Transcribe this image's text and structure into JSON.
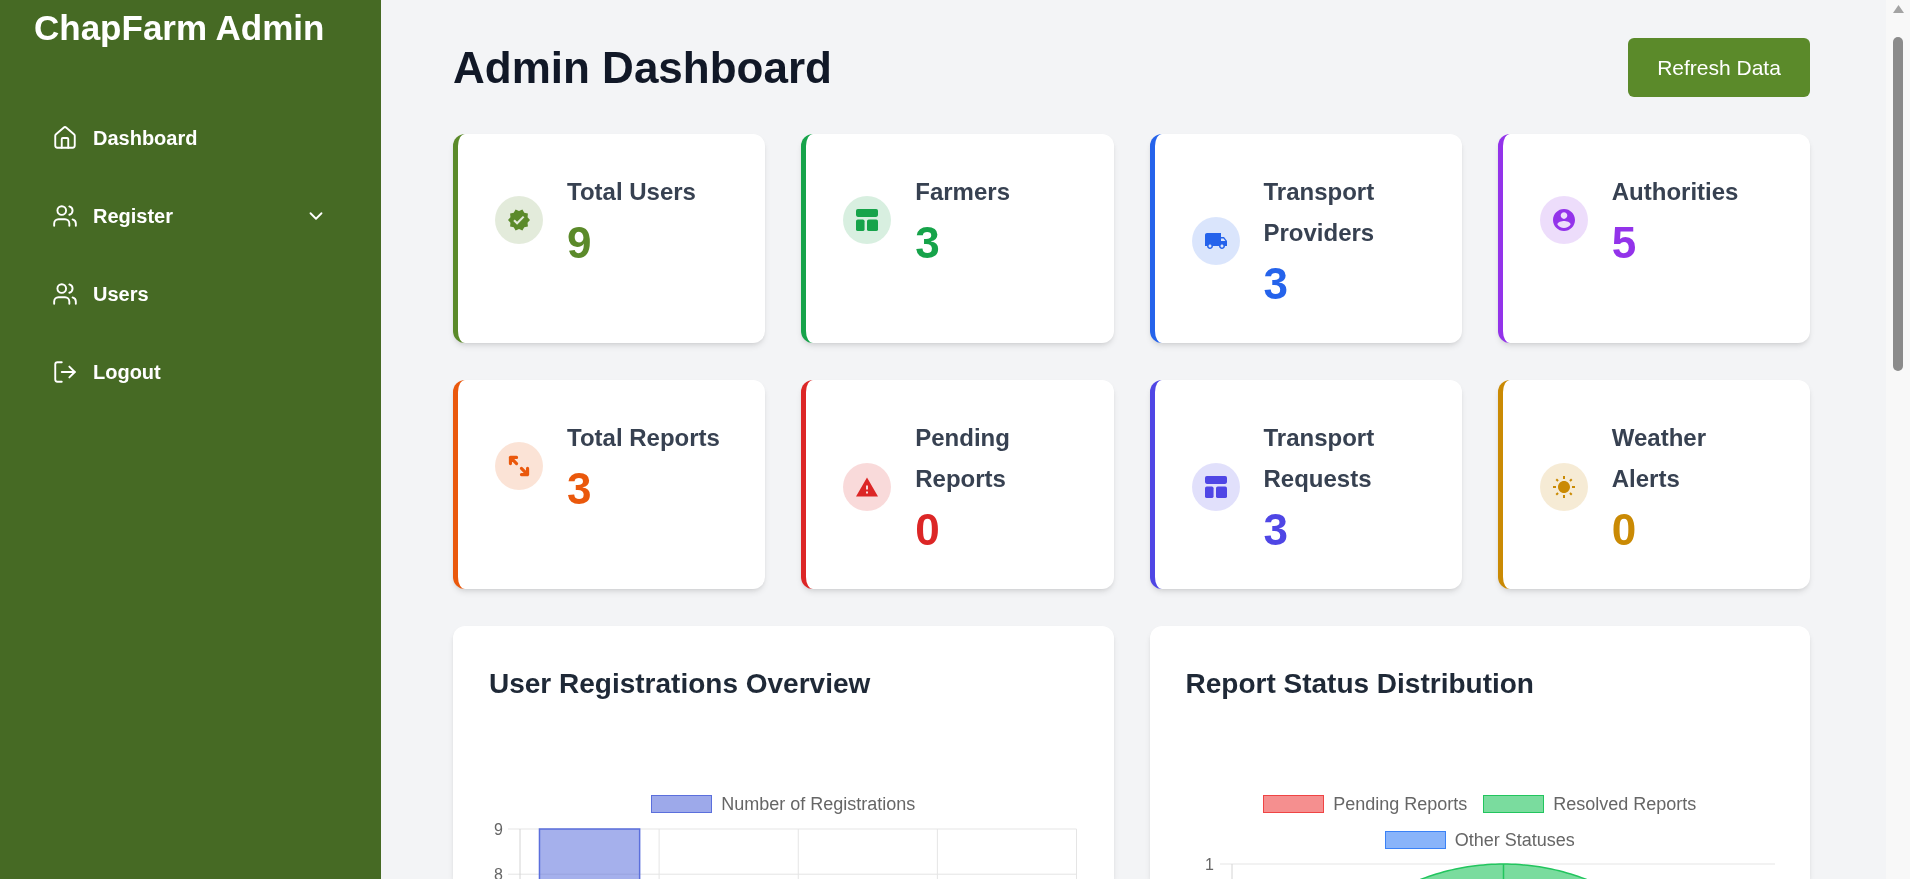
{
  "sidebar": {
    "title": "ChapFarm Admin",
    "items": [
      {
        "label": "Dashboard"
      },
      {
        "label": "Register",
        "expanded": false
      },
      {
        "label": "Users"
      },
      {
        "label": "Logout"
      }
    ]
  },
  "header": {
    "title": "Admin Dashboard",
    "refresh_button": "Refresh Data"
  },
  "stat_cards": [
    {
      "title": "Total Users",
      "value": "9",
      "color": "#5b8a2a"
    },
    {
      "title": "Farmers",
      "value": "3",
      "color": "#16a34a"
    },
    {
      "title": "Transport Providers",
      "value": "3",
      "color": "#2563eb"
    },
    {
      "title": "Authorities",
      "value": "5",
      "color": "#9333ea"
    },
    {
      "title": "Total Reports",
      "value": "3",
      "color": "#ea580c"
    },
    {
      "title": "Pending Reports",
      "value": "0",
      "color": "#dc2626"
    },
    {
      "title": "Transport Requests",
      "value": "3",
      "color": "#4f46e5"
    },
    {
      "title": "Weather Alerts",
      "value": "0",
      "color": "#ca8a04"
    }
  ],
  "charts": [
    {
      "title": "User Registrations Overview",
      "chart_data": {
        "type": "bar",
        "series": [
          {
            "name": "Number of Registrations",
            "color": "#5b6fdc",
            "values": [
              9,
              null,
              null,
              null
            ]
          }
        ],
        "ylim": [
          7.85,
          9
        ],
        "yticks": [
          8,
          9
        ]
      }
    },
    {
      "title": "Report Status Distribution",
      "y_axis_ticks": [
        "1"
      ],
      "chart_data": {
        "type": "pie",
        "categories": [
          "Pending Reports",
          "Resolved Reports",
          "Other Statuses"
        ],
        "values": [
          0,
          100,
          0
        ],
        "colors": [
          "#ef4444",
          "#22c55e",
          "#3b82f6"
        ]
      }
    }
  ]
}
